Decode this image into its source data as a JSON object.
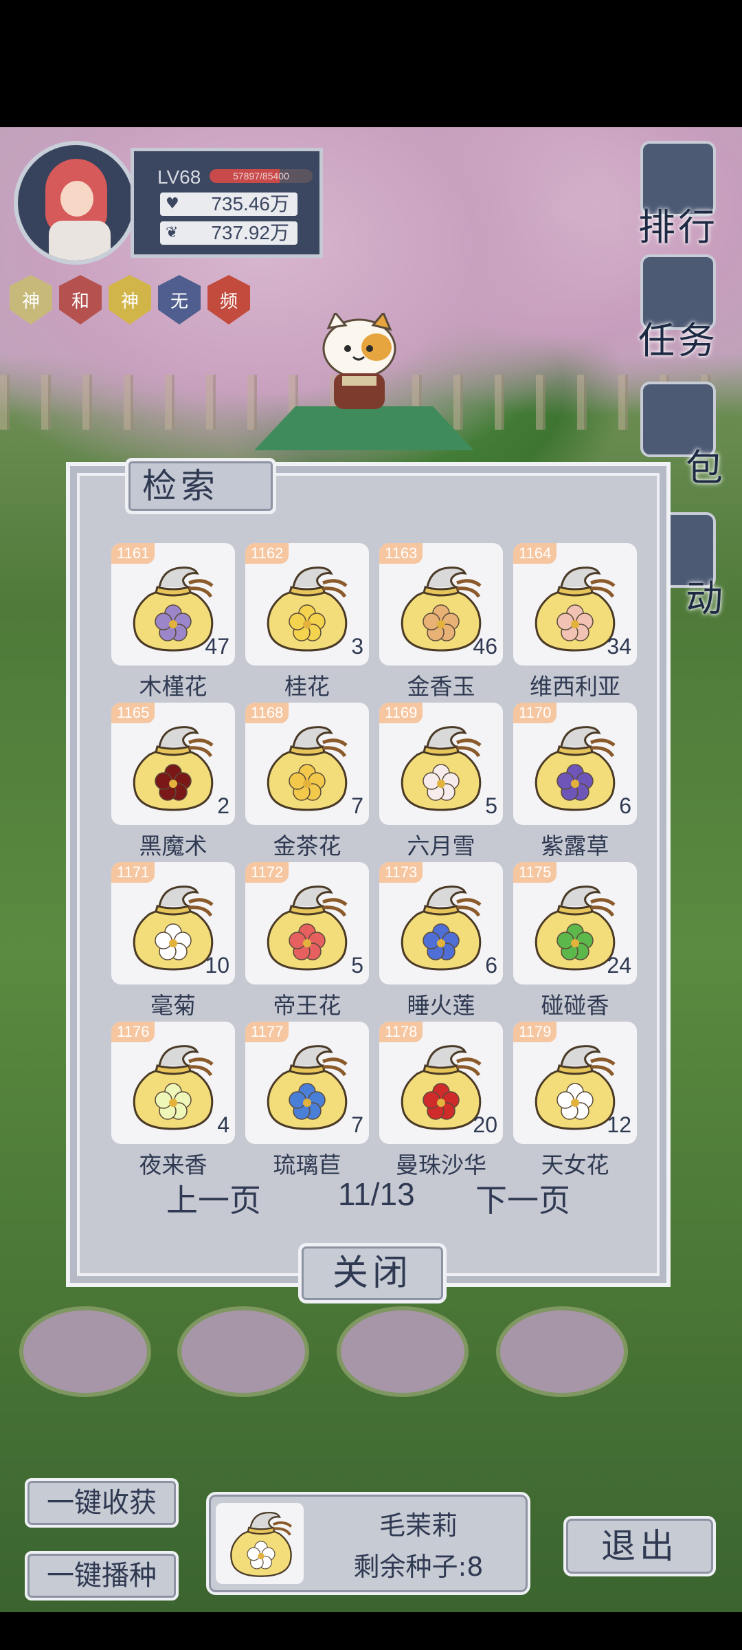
{
  "player": {
    "level": "LV68",
    "exp_text": "57897/85400",
    "exp_fraction": 0.678,
    "stat1": "735.46万",
    "stat2": "737.92万"
  },
  "badges": [
    {
      "label": "神",
      "color": "#c6b97a"
    },
    {
      "label": "和",
      "color": "#b5524f"
    },
    {
      "label": "神",
      "color": "#d1b548"
    },
    {
      "label": "无",
      "color": "#4f5e8e"
    },
    {
      "label": "频",
      "color": "#c24b3d"
    }
  ],
  "side_menu": {
    "rank": "排行",
    "task": "任务",
    "bag": "包",
    "event": "动"
  },
  "modal": {
    "title": "检索",
    "prev": "上一页",
    "page": "11/13",
    "next": "下一页",
    "close": "关闭"
  },
  "items": [
    {
      "id": "1161",
      "qty": "47",
      "name": "木槿花",
      "flower_color": "#9b86c9"
    },
    {
      "id": "1162",
      "qty": "3",
      "name": "桂花",
      "flower_color": "#f4d44e"
    },
    {
      "id": "1163",
      "qty": "46",
      "name": "金香玉",
      "flower_color": "#e8b277"
    },
    {
      "id": "1164",
      "qty": "34",
      "name": "维西利亚",
      "flower_color": "#f2c2b4"
    },
    {
      "id": "1165",
      "qty": "2",
      "name": "黑魔术",
      "flower_color": "#7a1717"
    },
    {
      "id": "1168",
      "qty": "7",
      "name": "金茶花",
      "flower_color": "#f2c94b"
    },
    {
      "id": "1169",
      "qty": "5",
      "name": "六月雪",
      "flower_color": "#f6ecec"
    },
    {
      "id": "1170",
      "qty": "6",
      "name": "紫露草",
      "flower_color": "#6e55b8"
    },
    {
      "id": "1171",
      "qty": "10",
      "name": "毫菊",
      "flower_color": "#ffffff"
    },
    {
      "id": "1172",
      "qty": "5",
      "name": "帝王花",
      "flower_color": "#e6605f"
    },
    {
      "id": "1173",
      "qty": "6",
      "name": "睡火莲",
      "flower_color": "#4f6fd6"
    },
    {
      "id": "1175",
      "qty": "24",
      "name": "碰碰香",
      "flower_color": "#5cb84a"
    },
    {
      "id": "1176",
      "qty": "4",
      "name": "夜来香",
      "flower_color": "#eef6b8"
    },
    {
      "id": "1177",
      "qty": "7",
      "name": "琉璃苣",
      "flower_color": "#4a7fd8"
    },
    {
      "id": "1178",
      "qty": "20",
      "name": "曼珠沙华",
      "flower_color": "#cf2b2b"
    },
    {
      "id": "1179",
      "qty": "12",
      "name": "天女花",
      "flower_color": "#ffffff"
    }
  ],
  "controls": {
    "harvest": "一键收获",
    "sow": "一键播种",
    "exit": "退出"
  },
  "seed": {
    "name": "毛茉莉",
    "remaining": "剩余种子:8",
    "flower_color": "#ffffff"
  }
}
